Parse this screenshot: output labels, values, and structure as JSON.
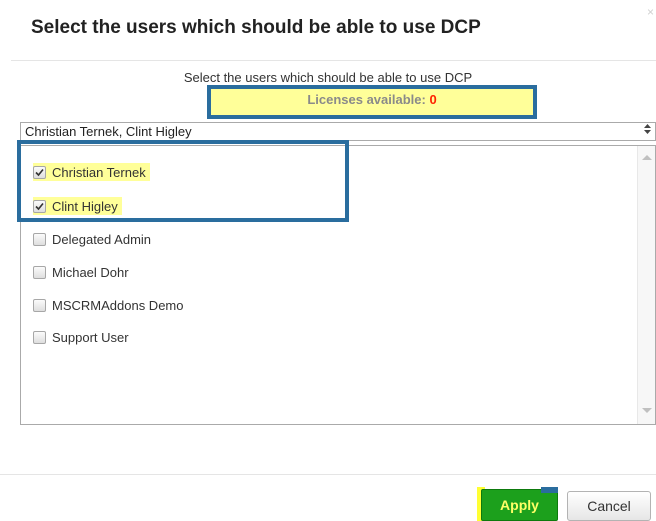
{
  "dialog": {
    "title": "Select the users which should be able to use DCP",
    "close_symbol": "×"
  },
  "header": {
    "subtitle": "Select the users which should be able to use DCP",
    "licenses_label": "Licenses available: ",
    "licenses_count": "0"
  },
  "select": {
    "value": "Christian Ternek, Clint Higley",
    "arrows": "▲▼"
  },
  "users": [
    {
      "label": "Christian Ternek",
      "checked": true,
      "highlighted": true
    },
    {
      "label": "Clint Higley",
      "checked": true,
      "highlighted": true
    },
    {
      "label": "Delegated Admin",
      "checked": false,
      "highlighted": false
    },
    {
      "label": "Michael Dohr",
      "checked": false,
      "highlighted": false
    },
    {
      "label": "MSCRMAddons Demo",
      "checked": false,
      "highlighted": false
    },
    {
      "label": "Support User",
      "checked": false,
      "highlighted": false
    }
  ],
  "footer": {
    "apply_label": "Apply",
    "cancel_label": "Cancel"
  },
  "colors": {
    "highlight_yellow": "#ffff99",
    "frame_blue": "#2a6d9e",
    "apply_green": "#1ca01c",
    "count_red": "#ff2200"
  },
  "icons": {
    "close": "close-icon",
    "select_arrows": "select-arrows-icon",
    "checkmark": "checkmark-icon"
  }
}
